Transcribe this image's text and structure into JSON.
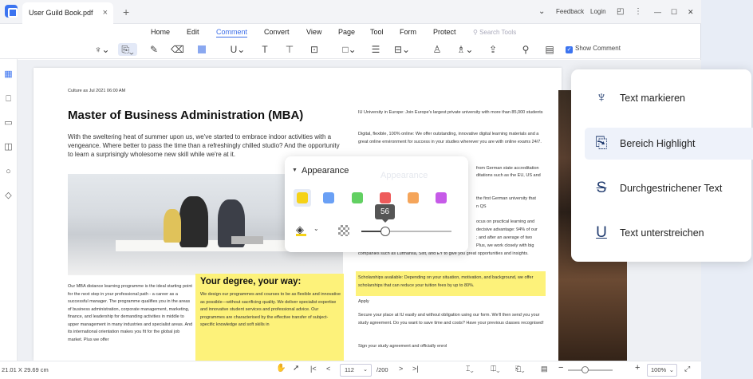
{
  "window": {
    "tab_title": "User Guild Book.pdf",
    "tab_close": "×",
    "tab_add": "+",
    "feedback": "Feedback",
    "login": "Login",
    "chevron": "⌄",
    "more": "⋮",
    "minimize": "—",
    "maximize": "☐",
    "close": "✕"
  },
  "menu": {
    "items": [
      "Home",
      "Edit",
      "Comment",
      "Convert",
      "View",
      "Page",
      "Tool",
      "Form",
      "Protect"
    ],
    "active": "Comment",
    "search_placeholder": "Search Tools"
  },
  "toolbar": {
    "show_comment_label": "Show Comment",
    "show_comment_checked": true
  },
  "document": {
    "dateline": "Culture as Jul 2021 06:00 AM",
    "title": "Master of Business Administration (MBA)",
    "intro": "With the sweltering heat of summer upon us, we've started to embrace indoor activities with a vengeance. Where better to pass the time than a refreshingly chilled studio? And the opportunity to learn a surprisingly wholesome new skill while we're at it.",
    "left_column": "Our MBA distance learning programme is the ideal starting point for the next step in your professional path - a career as a successful manager. The programme qualifies you in the areas of business administration, corporate management, marketing, finance, and leadership for demanding activities in middle to upper management in many industries and specialist areas. And its international orientation makes you fit for the global job market. Plus we offer",
    "yellow_title": "Your degree, your way:",
    "yellow_text": "We design our programmes and courses to be as flexible and innovative as possible—without sacrificing quality. We deliver specialist expertise and innovative student services and professional advice. Our programmes are characterised by the effective transfer of subject-specific knowledge and soft skills in",
    "right_top": "IU University in Europe: Join Europe's largest private university with more than 85,000 students",
    "right_digital": "Digital, flexible, 100% online: We offer outstanding, innovative digital learning materials and a great online environment for success in your studies wherever you are with online exams 24/7.",
    "right_frag1": "from German state accreditation",
    "right_frag2": "ditations such as the EU, US and",
    "right_frag3": "the first German university that",
    "right_frag4": "n QS",
    "right_frag5": "ocus on practical learning and",
    "right_frag6": "decisive advantage: 94% of our",
    "right_frag7": "; and after an average of two",
    "right_frag8": "Plus, we work closely with big",
    "right_companies": "companies such as Lufthansa, Sixt, and EY to give you great opportunities and insights.",
    "right_scholarship": "Scholarships available: Depending on your situation, motivation, and background, we offer scholarships that can reduce your tuition fees by up to 80%.",
    "right_apply": "Apply",
    "right_secure": "Secure your place at IU easily and without obligation using our form. We'll then send you your study agreement. Do you want to save time and costs? Have your previous classes recognised!",
    "right_sign": "Sign your study agreement and officially enrol"
  },
  "appearance_popup": {
    "title": "Appearance",
    "ghost_title": "Appearance",
    "colors": [
      "#f5d218",
      "#6aa0f5",
      "#62d062",
      "#ee5b5b",
      "#f5a55a",
      "#c65ae8"
    ],
    "selected_color_index": 0,
    "opacity_value": "56",
    "opacity": 0.56
  },
  "highlight_menu": {
    "items": [
      {
        "label": "Text markieren",
        "icon": "highlighter-icon"
      },
      {
        "label": "Bereich Highlight",
        "icon": "area-highlight-icon"
      },
      {
        "label": "Durchgestrichener Text",
        "icon": "strikethrough-icon"
      },
      {
        "label": "Text unterstreichen",
        "icon": "underline-icon"
      }
    ],
    "selected_index": 1
  },
  "status": {
    "page_size": "21.01 X 29.69 cm",
    "current_page": "112",
    "total_pages": "/200",
    "zoom": "100%",
    "zoom_minus": "−",
    "zoom_plus": "+"
  }
}
